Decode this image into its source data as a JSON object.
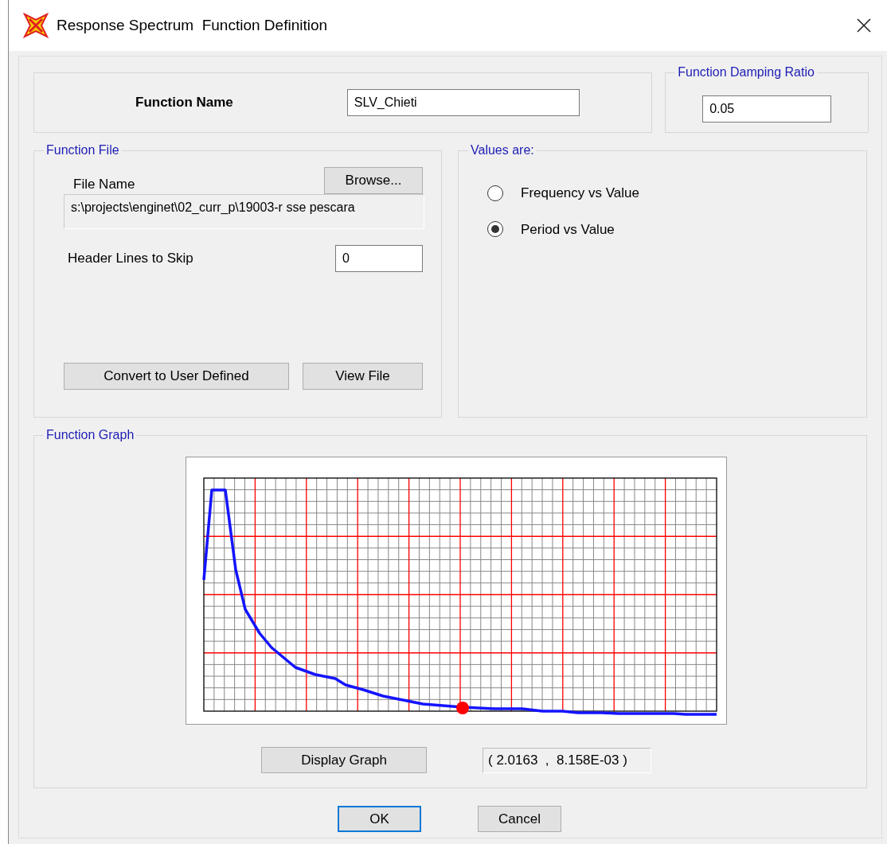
{
  "window": {
    "title": "Response Spectrum  Function Definition"
  },
  "function_name": {
    "label": "Function Name",
    "value": "SLV_Chieti"
  },
  "damping": {
    "legend": "Function Damping Ratio",
    "value": "0.05"
  },
  "function_file": {
    "legend": "Function File",
    "browse_button": "Browse...",
    "file_name_label": "File Name",
    "file_name": "s:\\projects\\enginet\\02_curr_p\\19003-r sse pescara",
    "header_lines_label": "Header Lines to Skip",
    "header_lines": "0",
    "buttons": [
      "Convert to User Defined",
      "View File"
    ]
  },
  "values_are": {
    "legend": "Values are:",
    "options": [
      {
        "label": "Frequency vs Value",
        "selected": false
      },
      {
        "label": "Period vs Value",
        "selected": true
      }
    ]
  },
  "function_graph": {
    "legend": "Function Graph",
    "display_button": "Display Graph",
    "coordinates": "( 2.0163  ,  8.158E-03 )"
  },
  "buttons": [
    {
      "label": "OK",
      "default": true
    },
    {
      "label": "Cancel",
      "default": false
    }
  ]
}
